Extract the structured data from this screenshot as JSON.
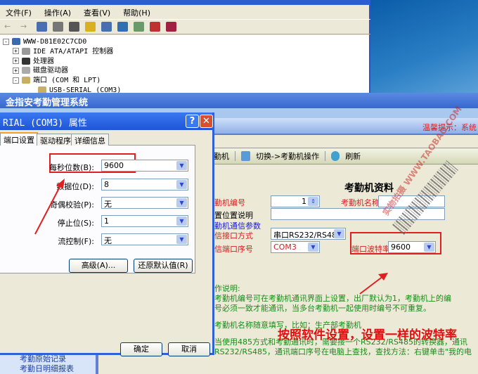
{
  "device_manager": {
    "menu": [
      "文件(F)",
      "操作(A)",
      "查看(V)",
      "帮助(H)"
    ],
    "tree": [
      {
        "label": "WWW-D81E02C7CD0",
        "expander": "-",
        "level": 0
      },
      {
        "label": "IDE ATA/ATAPI 控制器",
        "expander": "+",
        "level": 1
      },
      {
        "label": "处理器",
        "expander": "+",
        "level": 1
      },
      {
        "label": "磁盘驱动器",
        "expander": "+",
        "level": 1
      },
      {
        "label": "端口 (COM 和 LPT)",
        "expander": "-",
        "level": 1
      },
      {
        "label": "USB-SERIAL (COM3)",
        "expander": "",
        "level": 2
      }
    ]
  },
  "app": {
    "title": "金指安考勤管理系统",
    "tip": "温馨提示：系统",
    "toolbar": {
      "item1": "勤机",
      "item2": "切换->考勤机操作",
      "item3": "刷新"
    },
    "section_title": "考勤机资料",
    "form": {
      "machine_no_label": "勤机编号",
      "machine_no": "1",
      "machine_name_label": "考勤机名称",
      "machine_name": "",
      "location_label": "置位置说明",
      "location": "",
      "comm_params_label": "勤机通信参数",
      "interface_label": "信接口方式",
      "interface": "串口RS232/RS485",
      "port_label": "信端口序号",
      "port": "COM3",
      "baud_label": "端口波特率",
      "baud": "9600"
    },
    "help": [
      "作说明:",
      "考勤机编号可在考勤机通讯界面上设置，出厂默认为1，考勤机上的编",
      "号必须一致才能通讯，当多台考勤机一起使用时编号不可重复。",
      "考勤机名称随意填写，比如：生产部考勤机",
      "当使用485方式和考勤通讯时，需要接一个RS232/RS485的转换器，通讯",
      "RS232/RS485，通讯端口序号在电脑上查找，查找方法：右键单击\"我的电"
    ],
    "annotation": "按照软件设置，设置一样的波特率",
    "nav": [
      "考勤原始记录",
      "考勤日明细报表"
    ],
    "watermark": [
      "实物拍摄",
      "WWW.TAOBAO.COM"
    ]
  },
  "dialog": {
    "title": "RIAL (COM3) 属性",
    "help_btn": "?",
    "close_btn": "✕",
    "tabs": [
      "端口设置",
      "驱动程序",
      "详细信息"
    ],
    "fields": [
      {
        "label": "每秒位数(B):",
        "value": "9600"
      },
      {
        "label": "数据位(D):",
        "value": "8"
      },
      {
        "label": "奇偶校验(P):",
        "value": "无"
      },
      {
        "label": "停止位(S):",
        "value": "1"
      },
      {
        "label": "流控制(F):",
        "value": "无"
      }
    ],
    "advanced": "高级(A)...",
    "restore": "还原默认值(R)",
    "ok": "确定",
    "cancel": "取消"
  },
  "colors": {
    "accent_red": "#e02020",
    "help_green": "#1a8a1a",
    "title_blue": "#1f55d8"
  }
}
